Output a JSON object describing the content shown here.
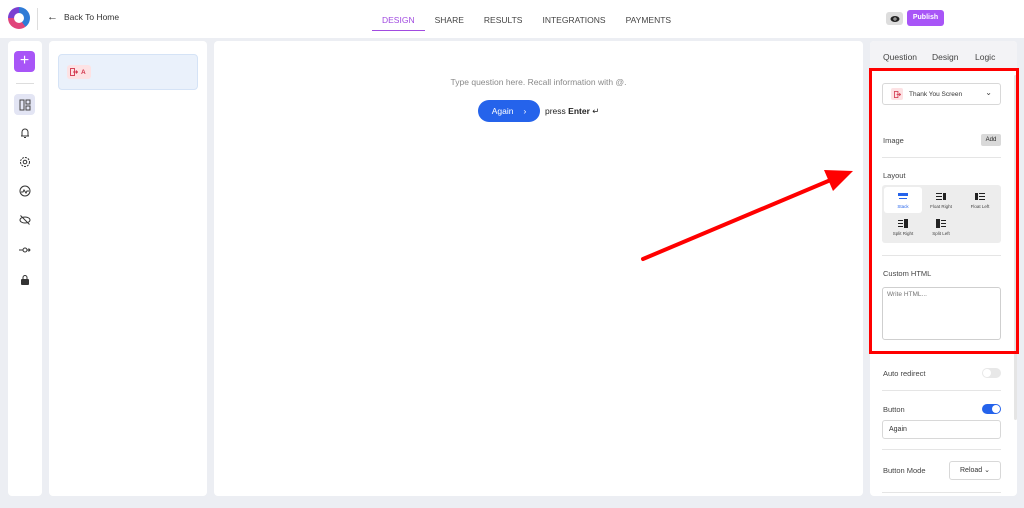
{
  "header": {
    "back_label": "Back To Home",
    "tabs": [
      "DESIGN",
      "SHARE",
      "RESULTS",
      "INTEGRATIONS",
      "PAYMENTS"
    ],
    "active_tab": "DESIGN",
    "publish_label": "Publish",
    "accent_color": "#a855f7"
  },
  "rail": {
    "icons": [
      "plus-icon",
      "layout-icon",
      "bell-icon",
      "settings-icon",
      "gauge-icon",
      "hidden-eye-icon",
      "flow-icon",
      "lock-icon"
    ]
  },
  "question_list": {
    "items": [
      {
        "icon": "exit-icon",
        "label": "A"
      }
    ]
  },
  "canvas": {
    "placeholder": "Type question here. Recall information with @.",
    "button_label": "Again",
    "press_label": "press",
    "enter_label": "Enter",
    "enter_glyph": "↵"
  },
  "right_panel": {
    "tabs": [
      "Question",
      "Design",
      "Logic"
    ],
    "active_tab": "Question",
    "type_select": "Thank You Screen",
    "image_label": "Image",
    "add_label": "Add",
    "layout_label": "Layout",
    "layout_options": [
      "Stack",
      "Float Right",
      "Float Left",
      "Split Right",
      "Split Left"
    ],
    "selected_layout": "Stack",
    "custom_html_label": "Custom HTML",
    "custom_html_placeholder": "Write HTML...",
    "auto_redirect_label": "Auto redirect",
    "auto_redirect": false,
    "button_label": "Button",
    "button_enabled": true,
    "button_text": "Again",
    "button_mode_label": "Button Mode",
    "button_mode_value": "Reload ⌄"
  },
  "annotation": {
    "highlight_color": "#ff0000"
  }
}
